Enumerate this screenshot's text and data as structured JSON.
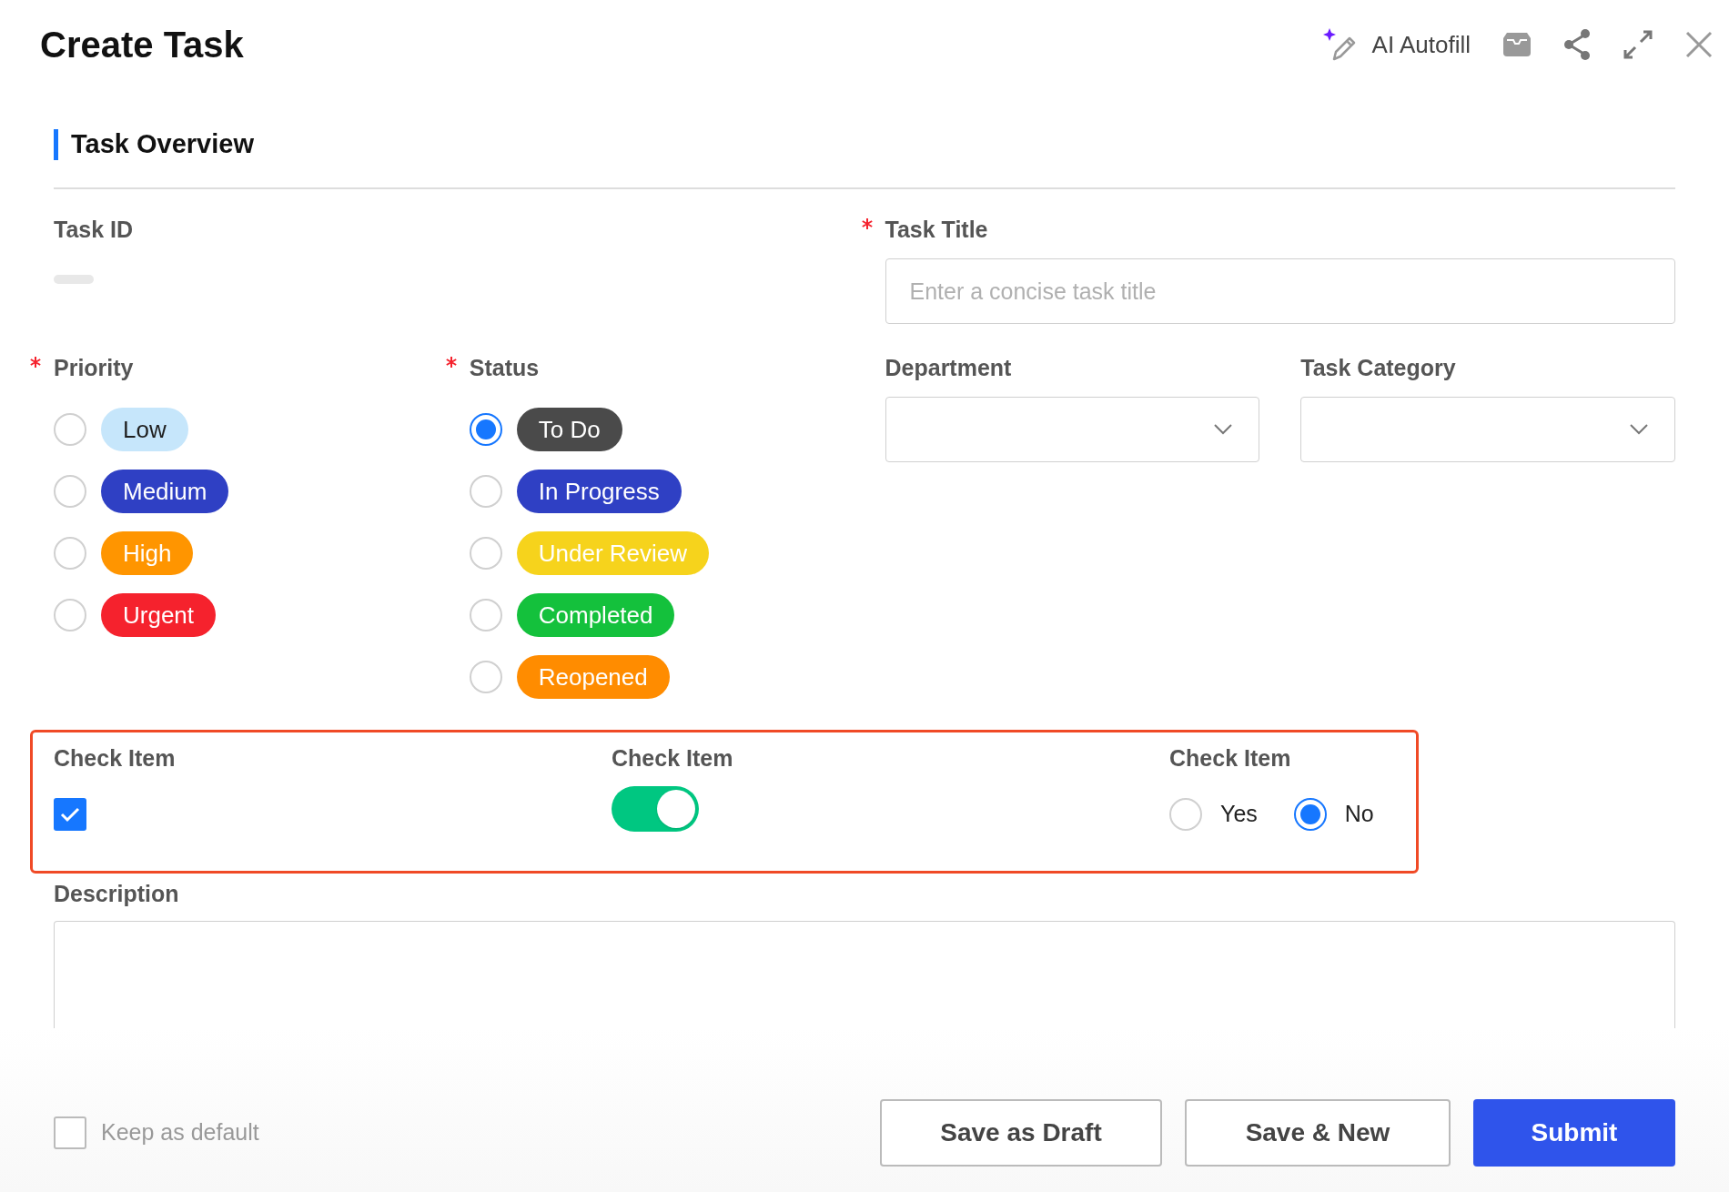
{
  "header": {
    "title": "Create Task",
    "ai_autofill": "AI Autofill"
  },
  "section_title": "Task Overview",
  "task_id": {
    "label": "Task ID"
  },
  "task_title": {
    "label": "Task Title",
    "required": true,
    "placeholder": "Enter a concise task title"
  },
  "priority": {
    "label": "Priority",
    "required": true,
    "options": [
      {
        "label": "Low",
        "color": "#c6e6fb",
        "selected": false
      },
      {
        "label": "Medium",
        "color": "#2f40c4",
        "selected": false
      },
      {
        "label": "High",
        "color": "#ff9500",
        "selected": false
      },
      {
        "label": "Urgent",
        "color": "#f5222d",
        "selected": false
      }
    ]
  },
  "status": {
    "label": "Status",
    "required": true,
    "options": [
      {
        "label": "To Do",
        "color": "#4a4a4a",
        "selected": true
      },
      {
        "label": "In Progress",
        "color": "#2f40c4",
        "selected": false
      },
      {
        "label": "Under Review",
        "color": "#f6d31c",
        "selected": false
      },
      {
        "label": "Completed",
        "color": "#14c13c",
        "selected": false
      },
      {
        "label": "Reopened",
        "color": "#ff8c00",
        "selected": false
      }
    ]
  },
  "department": {
    "label": "Department"
  },
  "task_category": {
    "label": "Task Category"
  },
  "check_items": [
    {
      "label": "Check Item",
      "kind": "checkbox",
      "checked": true
    },
    {
      "label": "Check Item",
      "kind": "switch",
      "on": true
    },
    {
      "label": "Check Item",
      "kind": "radio",
      "options": [
        {
          "label": "Yes",
          "selected": false
        },
        {
          "label": "No",
          "selected": true
        }
      ]
    }
  ],
  "description": {
    "label": "Description"
  },
  "keep_default": {
    "label": "Keep as default",
    "checked": false
  },
  "buttons": [
    {
      "label": "Save as Draft",
      "kind": "secondary"
    },
    {
      "label": "Save & New",
      "kind": "secondary"
    },
    {
      "label": "Submit",
      "kind": "primary"
    }
  ]
}
